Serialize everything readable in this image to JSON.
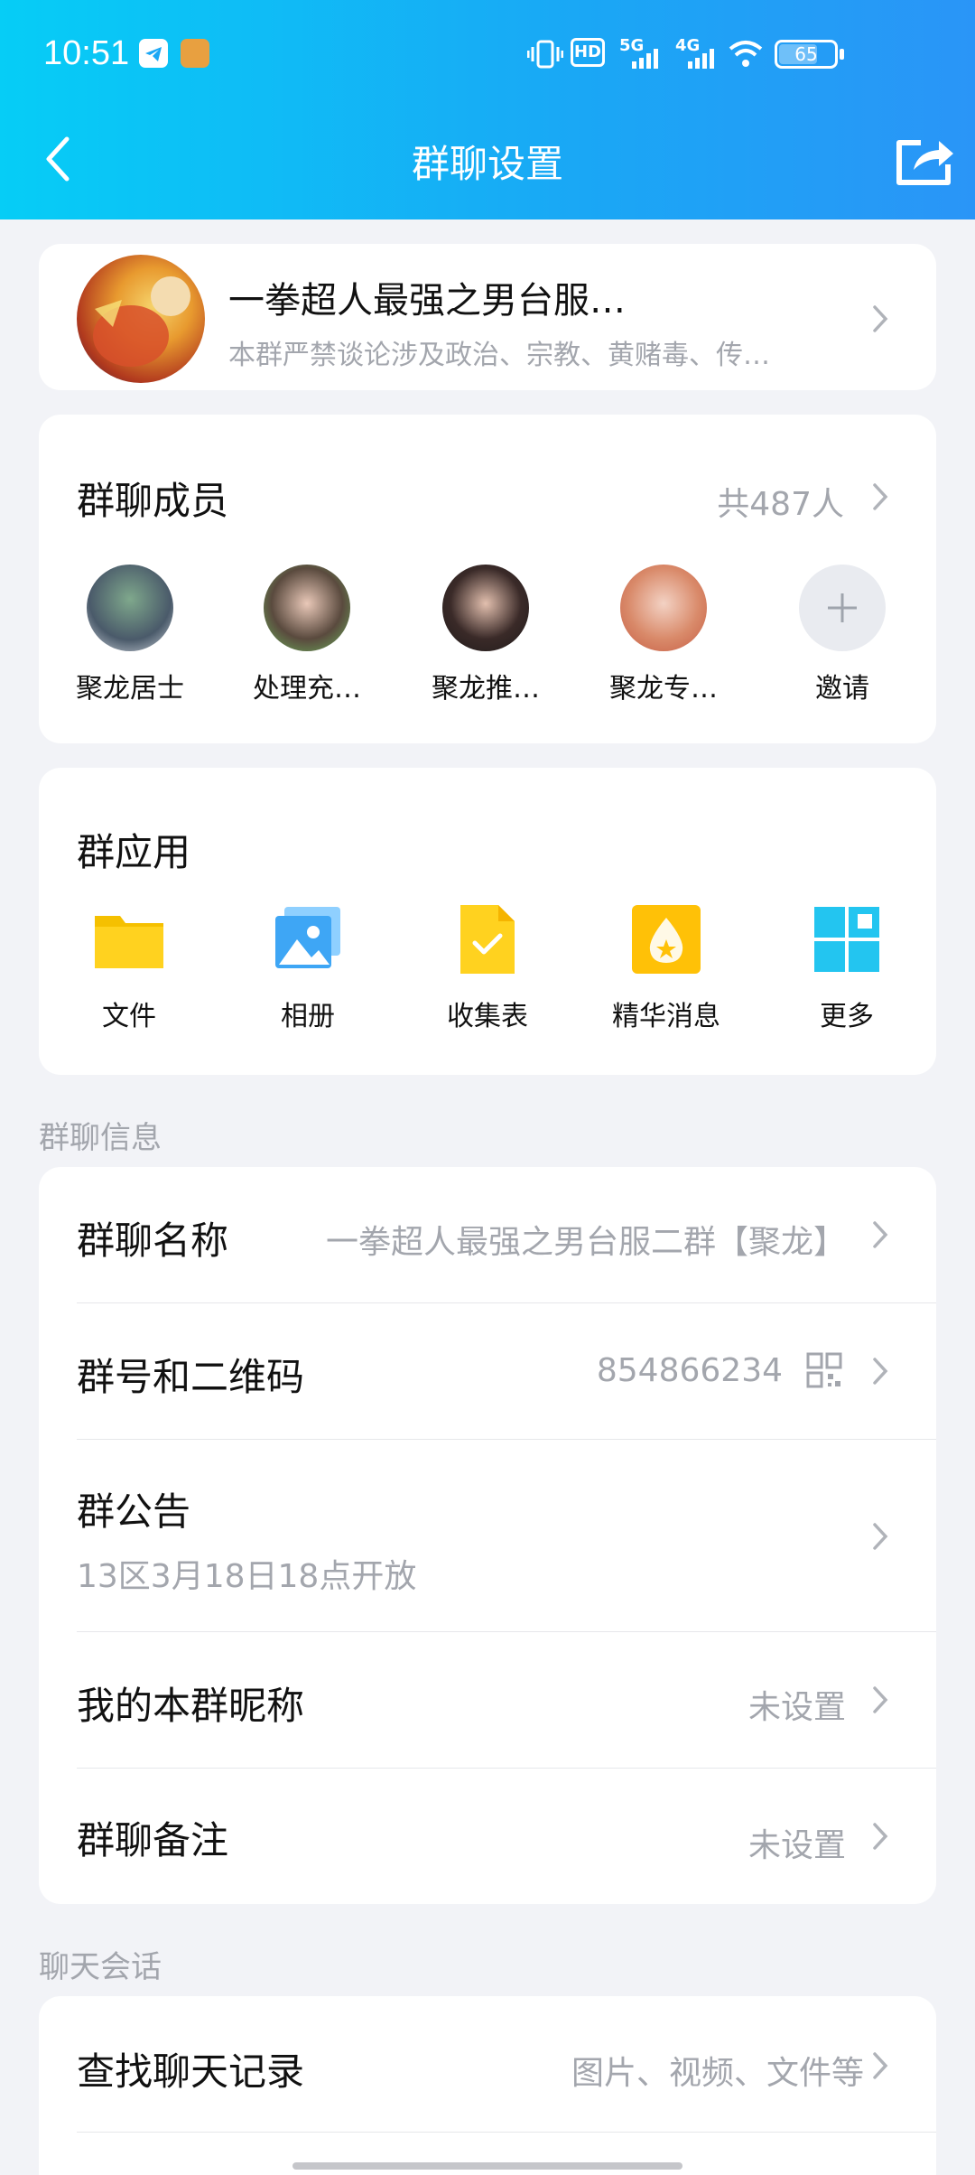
{
  "status_bar": {
    "time": "10:51",
    "battery": "65",
    "network_labels": [
      "HD",
      "5G",
      "4G"
    ]
  },
  "header": {
    "title": "群聊设置"
  },
  "group": {
    "name": "一拳超人最强之男台服…",
    "description": "本群严禁谈论涉及政治、宗教、黄赌毒、传…"
  },
  "members": {
    "title": "群聊成员",
    "count": "共487人",
    "list": [
      {
        "name": "聚龙居士"
      },
      {
        "name": "处理充…"
      },
      {
        "name": "聚龙推…"
      },
      {
        "name": "聚龙专…"
      }
    ],
    "invite_label": "邀请"
  },
  "apps": {
    "title": "群应用",
    "items": [
      {
        "label": "文件",
        "icon": "folder-icon"
      },
      {
        "label": "相册",
        "icon": "photo-album-icon"
      },
      {
        "label": "收集表",
        "icon": "form-icon"
      },
      {
        "label": "精华消息",
        "icon": "essence-icon"
      },
      {
        "label": "更多",
        "icon": "grid-icon"
      }
    ]
  },
  "info": {
    "section_label": "群聊信息",
    "group_name_label": "群聊名称",
    "group_name_value": "一拳超人最强之男台服二群【聚龙】",
    "group_id_label": "群号和二维码",
    "group_id_value": "854866234",
    "notice_label": "群公告",
    "notice_value": "13区3月18日18点开放",
    "nickname_label": "我的本群昵称",
    "nickname_value": "未设置",
    "remark_label": "群聊备注",
    "remark_value": "未设置"
  },
  "chat": {
    "section_label": "聊天会话",
    "search_label": "查找聊天记录",
    "search_value": "图片、视频、文件等"
  },
  "colors": {
    "header_start": "#06cdf6",
    "header_end": "#2a95f7",
    "background": "#f2f3f7",
    "muted_text": "#a3a6ad"
  }
}
